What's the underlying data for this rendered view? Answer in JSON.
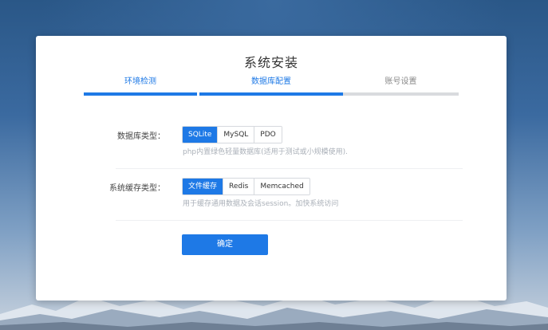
{
  "installer": {
    "title": "系统安装",
    "steps": [
      {
        "label": "环境检测",
        "state": "done"
      },
      {
        "label": "数据库配置",
        "state": "active"
      },
      {
        "label": "账号设置",
        "state": "pending"
      }
    ]
  },
  "form": {
    "database": {
      "label": "数据库类型：",
      "options": [
        "SQLite",
        "MySQL",
        "PDO"
      ],
      "selected": "SQLite",
      "help": "php内置绿色轻量数据库(适用于测试或小规模使用)."
    },
    "cache": {
      "label": "系统缓存类型：",
      "options": [
        "文件缓存",
        "Redis",
        "Memcached"
      ],
      "selected": "文件缓存",
      "help": "用于缓存通用数据及会话session。加快系统访问"
    },
    "submit_label": "确定"
  },
  "colors": {
    "accent": "#1e79e6",
    "inactive_bar": "#d9dbde"
  }
}
